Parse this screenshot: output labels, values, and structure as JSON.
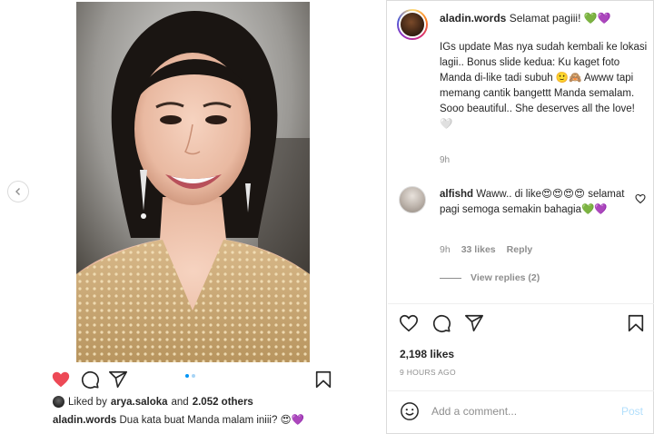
{
  "post": {
    "author": "aladin.words",
    "greeting": "Selamat pagiii! 💚💜",
    "body": "IGs update Mas nya sudah kembali ke lokasi lagii.. Bonus slide kedua: Ku kaget foto Manda di-like tadi subuh 🙂🙈 Awww tapi memang cantik bangettt Manda semalam. Sooo beautiful.. She deserves all the love! 🤍",
    "time": "9h"
  },
  "comment": {
    "author": "alfishd",
    "text": "Waww.. di like😍😍😍😍 selamat pagi semoga semakin bahagia💚💜",
    "time": "9h",
    "likes": "33 likes",
    "reply": "Reply",
    "view_replies": "View replies (2)"
  },
  "likes": {
    "count": "2,198 likes",
    "posted": "9 HOURS AGO"
  },
  "composer": {
    "placeholder": "Add a comment...",
    "post_label": "Post"
  },
  "left_panel": {
    "liked_by_prefix": "Liked by",
    "liked_by_user": "arya.saloka",
    "liked_by_and": "and",
    "liked_by_others": "2.052 others",
    "caption_author": "aladin.words",
    "caption_text": "Dua kata buat Manda malam iniii? 😍💜"
  },
  "icons": {
    "heart_filled": "heart-filled-icon",
    "heart": "heart-icon",
    "comment": "comment-icon",
    "share": "share-icon",
    "save": "bookmark-icon",
    "emoji": "smiley-icon",
    "prev": "chevron-left-icon"
  },
  "colors": {
    "like_red": "#ed4956",
    "link_blue": "#0095f6",
    "post_disabled": "#b2dffc"
  }
}
